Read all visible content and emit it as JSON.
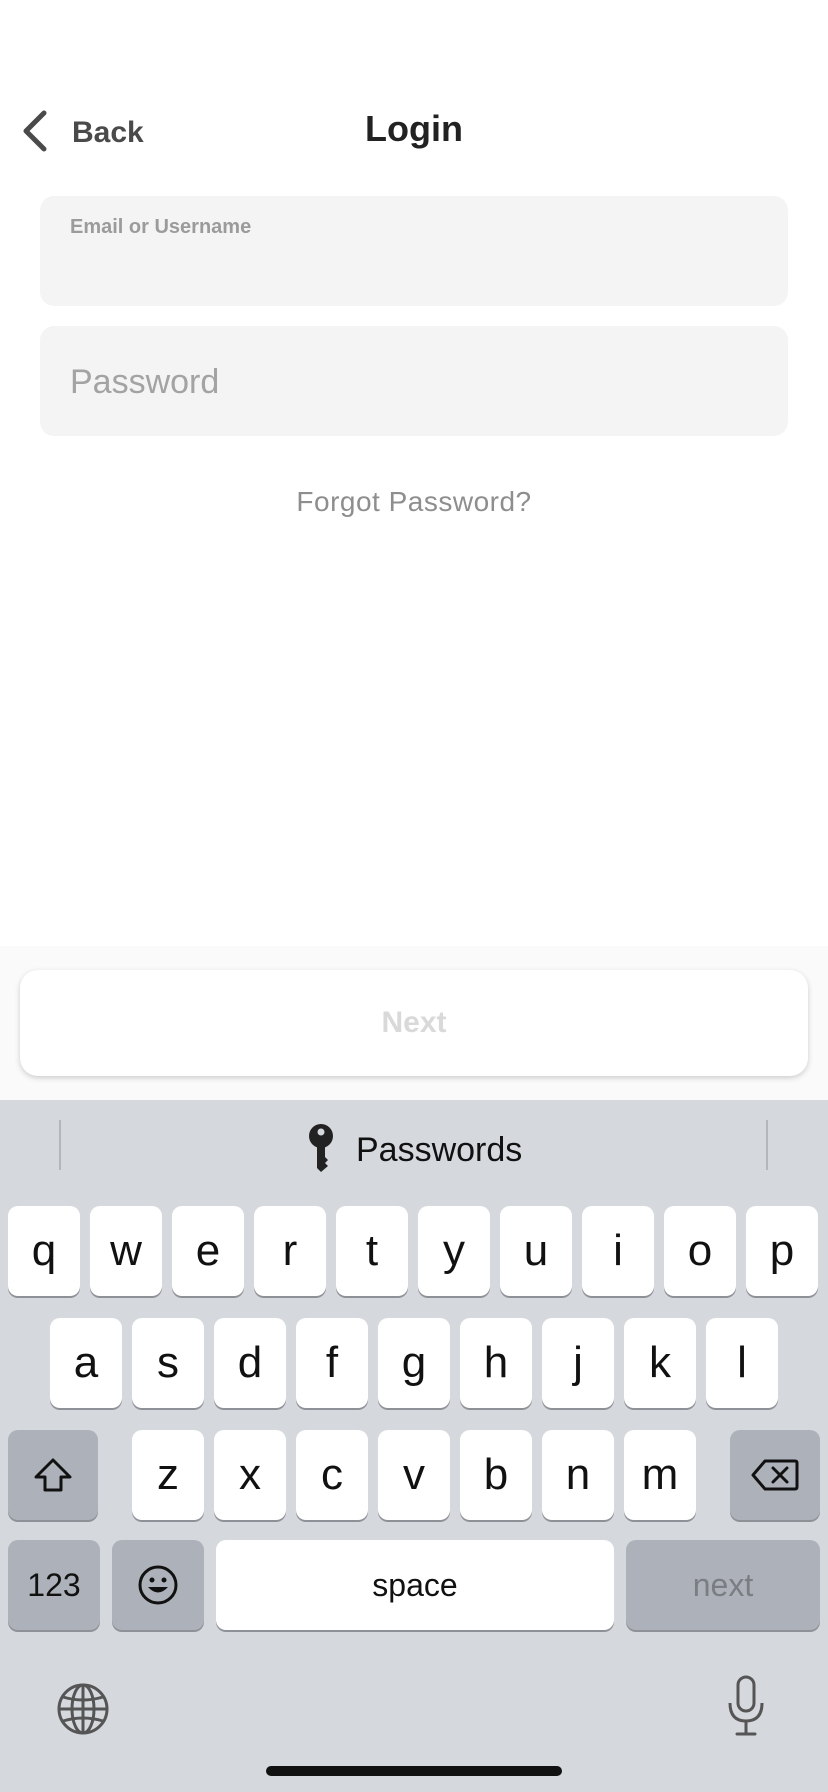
{
  "header": {
    "back_label": "Back",
    "title": "Login"
  },
  "form": {
    "email_label": "Email or Username",
    "email_value": "",
    "password_placeholder": "Password",
    "password_value": "",
    "forgot_label": "Forgot Password?"
  },
  "next_button_label": "Next",
  "keyboard": {
    "suggestion_label": "Passwords",
    "suggestion_icon": "key-icon",
    "row1": [
      "q",
      "w",
      "e",
      "r",
      "t",
      "y",
      "u",
      "i",
      "o",
      "p"
    ],
    "row2": [
      "a",
      "s",
      "d",
      "f",
      "g",
      "h",
      "j",
      "k",
      "l"
    ],
    "row3": [
      "z",
      "x",
      "c",
      "v",
      "b",
      "n",
      "m"
    ],
    "numbers_label": "123",
    "space_label": "space",
    "return_label": "next",
    "icons": [
      "shift-icon",
      "backspace-icon",
      "emoji-icon",
      "globe-icon",
      "microphone-icon"
    ]
  }
}
